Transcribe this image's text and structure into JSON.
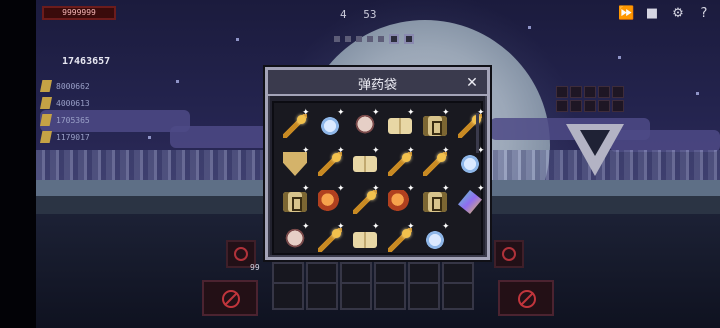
{
  "hud": {
    "hp_text": "9999999",
    "top_center_a": "4",
    "top_center_b": "53",
    "coins": "17463657",
    "stats": [
      "8000662",
      "4000613",
      "1705365",
      "1179017"
    ],
    "bottom_count": "99",
    "top_right_icons": [
      "fast-forward-icon",
      "bag-icon",
      "settings-icon",
      "help-icon"
    ]
  },
  "modal": {
    "title": "弹药袋",
    "close_label": "✕",
    "items": [
      {
        "icon": "golden-staff-icon",
        "shape": "staff"
      },
      {
        "icon": "ice-feather-icon",
        "shape": "feather"
      },
      {
        "icon": "skull-orb-icon",
        "shape": "skull"
      },
      {
        "icon": "spell-book-icon",
        "shape": "book"
      },
      {
        "icon": "ancient-scroll-icon",
        "shape": "scroll-item"
      },
      {
        "icon": "golden-staff-icon",
        "shape": "staff"
      },
      {
        "icon": "golden-shield-icon",
        "shape": "shield"
      },
      {
        "icon": "golden-staff-icon",
        "shape": "staff"
      },
      {
        "icon": "spell-book-icon",
        "shape": "book"
      },
      {
        "icon": "golden-staff-icon",
        "shape": "staff"
      },
      {
        "icon": "golden-staff-icon",
        "shape": "staff"
      },
      {
        "icon": "ice-feather-icon",
        "shape": "feather"
      },
      {
        "icon": "ancient-scroll-icon",
        "shape": "scroll-item"
      },
      {
        "icon": "fire-orb-icon",
        "shape": "orb"
      },
      {
        "icon": "golden-staff-icon",
        "shape": "staff"
      },
      {
        "icon": "fire-orb-icon",
        "shape": "orb"
      },
      {
        "icon": "ancient-scroll-icon",
        "shape": "scroll-item"
      },
      {
        "icon": "rainbow-leaf-icon",
        "shape": "leaf"
      },
      {
        "icon": "skull-orb-icon",
        "shape": "skull"
      },
      {
        "icon": "golden-staff-icon",
        "shape": "staff"
      },
      {
        "icon": "spell-book-icon",
        "shape": "book"
      },
      {
        "icon": "golden-staff-icon",
        "shape": "staff"
      },
      {
        "icon": "ice-feather-icon",
        "shape": "feather"
      }
    ]
  }
}
